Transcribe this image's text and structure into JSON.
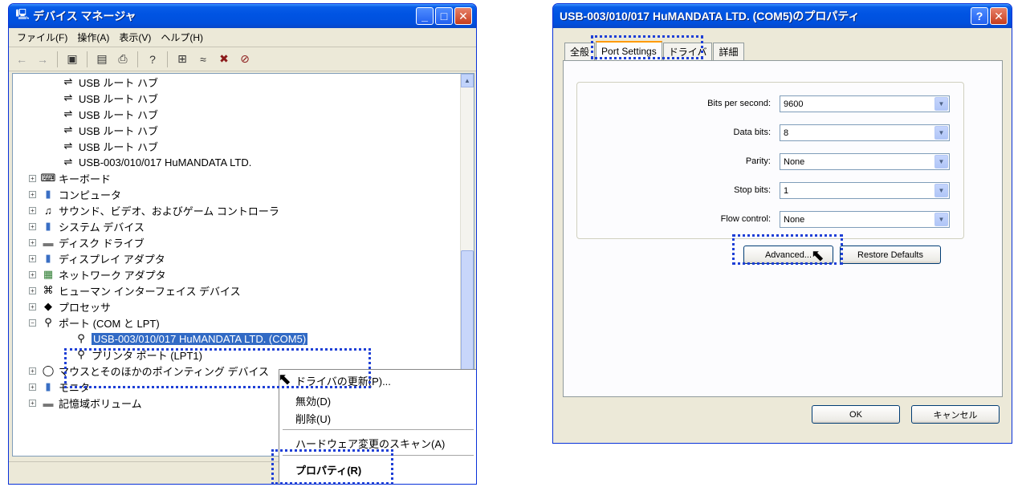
{
  "device_manager": {
    "title": "デバイス マネージャ",
    "menu": [
      "ファイル(F)",
      "操作(A)",
      "表示(V)",
      "ヘルプ(H)"
    ],
    "tree": {
      "usb_hubs": [
        "USB ルート ハブ",
        "USB ルート ハブ",
        "USB ルート ハブ",
        "USB ルート ハブ",
        "USB ルート ハブ"
      ],
      "usb_device": "USB-003/010/017 HuMANDATA LTD.",
      "categories": [
        "キーボード",
        "コンピュータ",
        "サウンド、ビデオ、およびゲーム コントローラ",
        "システム デバイス",
        "ディスク ドライブ",
        "ディスプレイ アダプタ",
        "ネットワーク アダプタ",
        "ヒューマン インターフェイス デバイス",
        "プロセッサ"
      ],
      "ports_category": "ポート (COM と LPT)",
      "selected_port": "USB-003/010/017 HuMANDATA LTD. (COM5)",
      "printer_port": "プリンタ ポート (LPT1)",
      "after_ports": [
        "マウスとそのほかのポインティング デバイス",
        "モニタ",
        "記憶域ボリューム"
      ]
    },
    "context_menu": {
      "update_driver": "ドライバの更新(P)...",
      "disable": "無効(D)",
      "uninstall": "削除(U)",
      "scan": "ハードウェア変更のスキャン(A)",
      "properties": "プロパティ(R)"
    }
  },
  "properties_dialog": {
    "title": "USB-003/010/017 HuMANDATA LTD. (COM5)のプロパティ",
    "tabs": [
      "全般",
      "Port Settings",
      "ドライバ",
      "詳細"
    ],
    "fields": [
      {
        "label": "Bits per second:",
        "value": "9600"
      },
      {
        "label": "Data bits:",
        "value": "8"
      },
      {
        "label": "Parity:",
        "value": "None"
      },
      {
        "label": "Stop bits:",
        "value": "1"
      },
      {
        "label": "Flow control:",
        "value": "None"
      }
    ],
    "advanced_button": "Advanced...",
    "restore_button": "Restore Defaults",
    "ok_button": "OK",
    "cancel_button": "キャンセル"
  },
  "colors": {
    "titlebar": "#0054e3",
    "highlight_frame": "#1e3fd6",
    "selection": "#316ac5",
    "window_face": "#ece9d8"
  }
}
